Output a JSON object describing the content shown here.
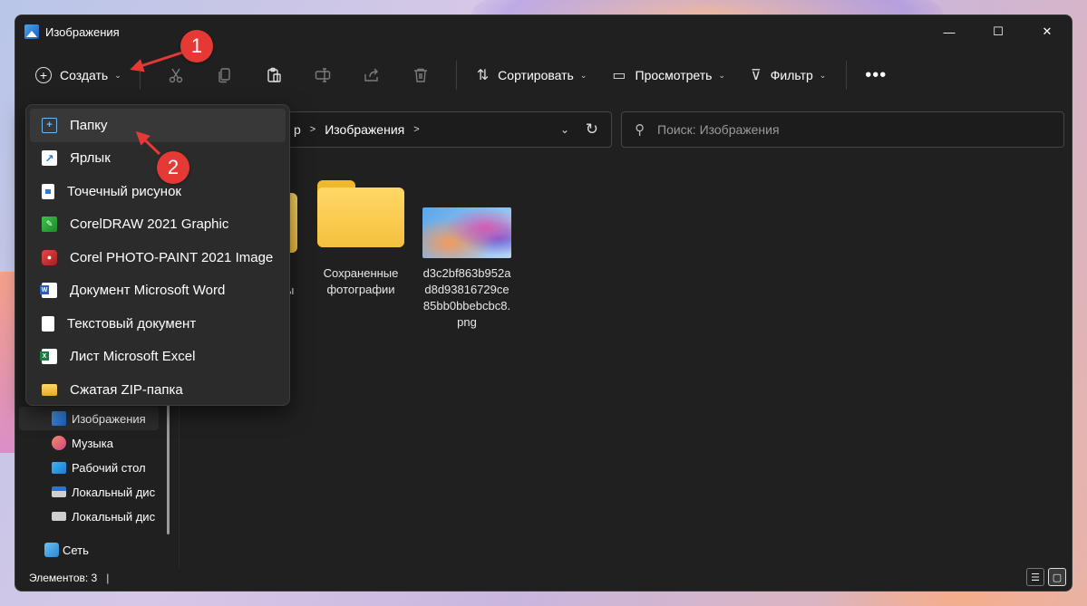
{
  "window": {
    "title": "Изображения",
    "controls": {
      "minimize": "—",
      "maximize": "☐",
      "close": "✕"
    }
  },
  "toolbar": {
    "create_label": "Создать",
    "sort_label": "Сортировать",
    "view_label": "Просмотреть",
    "filter_label": "Фильтр",
    "more_label": "•••"
  },
  "address": {
    "crumbs": [
      "р",
      "Изображения"
    ],
    "search_placeholder": "Поиск: Изображения"
  },
  "create_menu": {
    "items": [
      {
        "label": "Папку",
        "icon": "folder-plus-icon"
      },
      {
        "label": "Ярлык",
        "icon": "shortcut-icon"
      },
      {
        "label": "Точечный рисунок",
        "icon": "bitmap-icon"
      },
      {
        "label": "CorelDRAW 2021 Graphic",
        "icon": "coreldraw-icon"
      },
      {
        "label": "Corel PHOTO-PAINT 2021 Image",
        "icon": "corel-photopaint-icon"
      },
      {
        "label": "Документ Microsoft Word",
        "icon": "word-icon"
      },
      {
        "label": "Текстовый документ",
        "icon": "text-document-icon"
      },
      {
        "label": "Лист Microsoft Excel",
        "icon": "excel-icon"
      },
      {
        "label": "Сжатая ZIP-папка",
        "icon": "zip-folder-icon"
      }
    ]
  },
  "nav": {
    "items": [
      {
        "label": "Изображения",
        "selected": true
      },
      {
        "label": "Музыка"
      },
      {
        "label": "Рабочий стол"
      },
      {
        "label": "Локальный дис"
      },
      {
        "label": "Локальный дис"
      },
      {
        "label": "Сеть"
      }
    ]
  },
  "files": {
    "partial_label": "ы",
    "items": [
      {
        "name": "Сохраненные фотографии",
        "type": "folder"
      },
      {
        "name": "d3c2bf863b952ad8d93816729ce85bb0bbebcbc8.png",
        "type": "image"
      }
    ]
  },
  "status": {
    "count": "Элементов: 3",
    "sep": "|"
  },
  "annotations": {
    "badge1": "1",
    "badge2": "2",
    "color": "#e53935"
  }
}
